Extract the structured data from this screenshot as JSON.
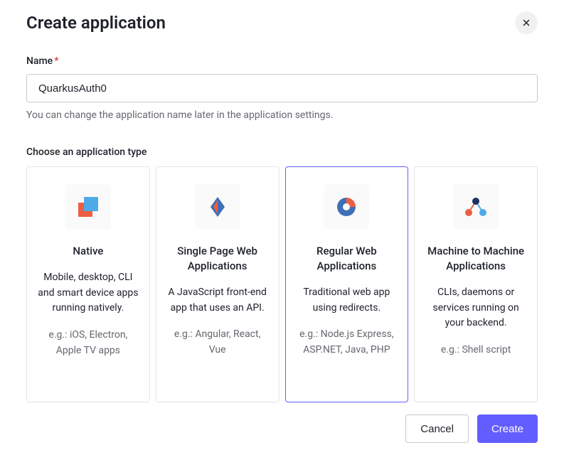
{
  "dialog": {
    "title": "Create application"
  },
  "name_field": {
    "label": "Name",
    "value": "QuarkusAuth0",
    "hint": "You can change the application name later in the application settings."
  },
  "type_section": {
    "label": "Choose an application type"
  },
  "cards": [
    {
      "title": "Native",
      "description": "Mobile, desktop, CLI and smart device apps running natively.",
      "example": "e.g.: iOS, Electron, Apple TV apps",
      "selected": false
    },
    {
      "title": "Single Page Web Applications",
      "description": "A JavaScript front-end app that uses an API.",
      "example": "e.g.: Angular, React, Vue",
      "selected": false
    },
    {
      "title": "Regular Web Applications",
      "description": "Traditional web app using redirects.",
      "example": "e.g.: Node.js Express, ASP.NET, Java, PHP",
      "selected": true
    },
    {
      "title": "Machine to Machine Applications",
      "description": "CLIs, daemons or services running on your backend.",
      "example": "e.g.: Shell script",
      "selected": false
    }
  ],
  "footer": {
    "cancel": "Cancel",
    "create": "Create"
  }
}
